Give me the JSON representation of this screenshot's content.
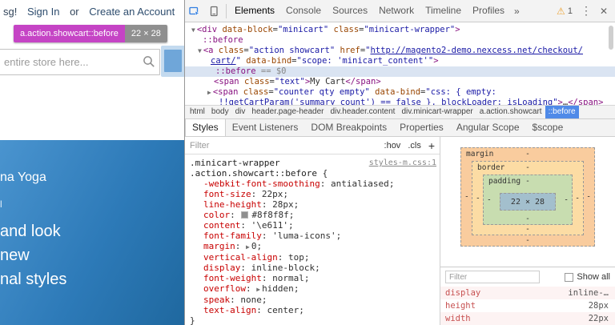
{
  "page": {
    "welcome_suffix": "sg!",
    "sign_in": "Sign In",
    "or_text": "or",
    "create_account": "Create an Account",
    "tooltip": {
      "selector": "a.action.showcart::before",
      "dimensions": "22 × 28"
    },
    "search_placeholder": "entire store here...",
    "hero_lines": [
      "na Yoga",
      "l",
      "and look",
      "new",
      "nal styles"
    ]
  },
  "devtools": {
    "tabs": [
      "Elements",
      "Console",
      "Sources",
      "Network",
      "Timeline",
      "Profiles",
      "»"
    ],
    "warning_count": "1",
    "breadcrumbs": [
      "html",
      "body",
      "div",
      "header.page-header",
      "div.header.content",
      "div.minicart-wrapper",
      "a.action.showcart",
      "::before"
    ],
    "subtabs": [
      "Styles",
      "Event Listeners",
      "DOM Breakpoints",
      "Properties",
      "Angular Scope",
      "$scope"
    ],
    "tree": {
      "l1": [
        {
          "t": "▼",
          "c": "arr"
        },
        {
          "t": "<div ",
          "c": "tag"
        },
        {
          "t": "data-block",
          "c": "attr"
        },
        {
          "t": "=",
          "c": "pln"
        },
        {
          "t": "\"minicart\"",
          "c": "val"
        },
        {
          "t": " ",
          "c": "pln"
        },
        {
          "t": "class",
          "c": "attr"
        },
        {
          "t": "=",
          "c": "pln"
        },
        {
          "t": "\"minicart-wrapper\"",
          "c": "val"
        },
        {
          "t": ">",
          "c": "tag"
        }
      ],
      "l2": [
        {
          "t": "::before",
          "c": "tag"
        }
      ],
      "l3": [
        {
          "t": "▼",
          "c": "arr"
        },
        {
          "t": "<a ",
          "c": "tag"
        },
        {
          "t": "class",
          "c": "attr"
        },
        {
          "t": "=",
          "c": "pln"
        },
        {
          "t": "\"action showcart\"",
          "c": "val"
        },
        {
          "t": " ",
          "c": "pln"
        },
        {
          "t": "href",
          "c": "attr"
        },
        {
          "t": "=",
          "c": "pln"
        },
        {
          "t": "\"",
          "c": "val"
        },
        {
          "t": "http://magento2-demo.nexcess.net/checkout/",
          "c": "lnk"
        }
      ],
      "l4": [
        {
          "t": "cart/",
          "c": "lnk"
        },
        {
          "t": "\"",
          "c": "val"
        },
        {
          "t": " ",
          "c": "pln"
        },
        {
          "t": "data-bind",
          "c": "attr"
        },
        {
          "t": "=",
          "c": "pln"
        },
        {
          "t": "\"scope: 'minicart_content'\"",
          "c": "val"
        },
        {
          "t": ">",
          "c": "tag"
        }
      ],
      "l5": [
        {
          "t": "::before",
          "c": "tag"
        },
        {
          "t": " == $0",
          "c": "meta"
        }
      ],
      "l6": [
        {
          "t": "<span ",
          "c": "tag"
        },
        {
          "t": "class",
          "c": "attr"
        },
        {
          "t": "=",
          "c": "pln"
        },
        {
          "t": "\"text\"",
          "c": "val"
        },
        {
          "t": ">",
          "c": "tag"
        },
        {
          "t": "My Cart",
          "c": "pln"
        },
        {
          "t": "</span>",
          "c": "tag"
        }
      ],
      "l7": [
        {
          "t": "▶",
          "c": "arr"
        },
        {
          "t": "<span ",
          "c": "tag"
        },
        {
          "t": "class",
          "c": "attr"
        },
        {
          "t": "=",
          "c": "pln"
        },
        {
          "t": "\"counter qty empty\"",
          "c": "val"
        },
        {
          "t": " ",
          "c": "pln"
        },
        {
          "t": "data-bind",
          "c": "attr"
        },
        {
          "t": "=",
          "c": "pln"
        },
        {
          "t": "\"css: { empty:",
          "c": "val"
        }
      ],
      "l8": [
        {
          "t": "!!getCartParam('summary_count') == false }, blockLoader: isLoading\"",
          "c": "val"
        },
        {
          "t": ">",
          "c": "tag"
        },
        {
          "t": "…",
          "c": "pln"
        },
        {
          "t": "</span>",
          "c": "tag"
        }
      ]
    },
    "styles": {
      "filter_placeholder": "Filter",
      "toggles": {
        "hov": ":hov",
        "cls": ".cls",
        "plus": "+"
      },
      "source": "styles-m.css:1",
      "sel1": [
        {
          "t": ".minicart-wrapper",
          "c": "sel"
        }
      ],
      "sel2": [
        {
          "t": ".action.showcart::before",
          "c": "sel"
        },
        {
          "t": " {",
          "c": "pln"
        }
      ],
      "p1": [
        {
          "t": "-webkit-font-smoothing",
          "c": "prop"
        },
        {
          "t": ": ",
          "c": "pln"
        },
        {
          "t": "antialiased",
          "c": "cval"
        },
        {
          "t": ";",
          "c": "pln"
        }
      ],
      "p2": [
        {
          "t": "font-size",
          "c": "prop"
        },
        {
          "t": ": ",
          "c": "pln"
        },
        {
          "t": "22px",
          "c": "cval"
        },
        {
          "t": ";",
          "c": "pln"
        }
      ],
      "p3": [
        {
          "t": "line-height",
          "c": "prop"
        },
        {
          "t": ": ",
          "c": "pln"
        },
        {
          "t": "28px",
          "c": "cval"
        },
        {
          "t": ";",
          "c": "pln"
        }
      ],
      "p4": [
        {
          "t": "color",
          "c": "prop"
        },
        {
          "t": ": ",
          "c": "pln"
        },
        {
          "t": "#8f8f8f",
          "c": "swatch"
        },
        {
          "t": "#8f8f8f",
          "c": "cval"
        },
        {
          "t": ";",
          "c": "pln"
        }
      ],
      "p5": [
        {
          "t": "content",
          "c": "prop"
        },
        {
          "t": ": ",
          "c": "pln"
        },
        {
          "t": "'\\e611'",
          "c": "cval"
        },
        {
          "t": ";",
          "c": "pln"
        }
      ],
      "p6": [
        {
          "t": "font-family",
          "c": "prop"
        },
        {
          "t": ": ",
          "c": "pln"
        },
        {
          "t": "'luma-icons'",
          "c": "cval"
        },
        {
          "t": ";",
          "c": "pln"
        }
      ],
      "p7": [
        {
          "t": "margin",
          "c": "prop"
        },
        {
          "t": ": ",
          "c": "pln"
        },
        {
          "t": "▶",
          "c": "arr"
        },
        {
          "t": "0",
          "c": "cval"
        },
        {
          "t": ";",
          "c": "pln"
        }
      ],
      "p8": [
        {
          "t": "vertical-align",
          "c": "prop"
        },
        {
          "t": ": ",
          "c": "pln"
        },
        {
          "t": "top",
          "c": "cval"
        },
        {
          "t": ";",
          "c": "pln"
        }
      ],
      "p9": [
        {
          "t": "display",
          "c": "prop"
        },
        {
          "t": ": ",
          "c": "pln"
        },
        {
          "t": "inline-block",
          "c": "cval"
        },
        {
          "t": ";",
          "c": "pln"
        }
      ],
      "p10": [
        {
          "t": "font-weight",
          "c": "prop"
        },
        {
          "t": ": ",
          "c": "pln"
        },
        {
          "t": "normal",
          "c": "cval"
        },
        {
          "t": ";",
          "c": "pln"
        }
      ],
      "p11": [
        {
          "t": "overflow",
          "c": "prop"
        },
        {
          "t": ": ",
          "c": "pln"
        },
        {
          "t": "▶",
          "c": "arr"
        },
        {
          "t": "hidden",
          "c": "cval"
        },
        {
          "t": ";",
          "c": "pln"
        }
      ],
      "p12": [
        {
          "t": "speak",
          "c": "prop"
        },
        {
          "t": ": ",
          "c": "pln"
        },
        {
          "t": "none",
          "c": "cval"
        },
        {
          "t": ";",
          "c": "pln"
        }
      ],
      "p13": [
        {
          "t": "text-align",
          "c": "prop"
        },
        {
          "t": ": ",
          "c": "pln"
        },
        {
          "t": "center",
          "c": "cval"
        },
        {
          "t": ";",
          "c": "pln"
        }
      ],
      "close": [
        {
          "t": "}",
          "c": "pln"
        }
      ]
    },
    "box_model": {
      "margin": "margin",
      "border": "border",
      "padding": "padding",
      "content": "22 × 28",
      "dash": "-"
    },
    "computed": {
      "filter_placeholder": "Filter",
      "show_all": "Show all",
      "rows": [
        {
          "name": "display",
          "value": "inline-…"
        },
        {
          "name": "height",
          "value": "28px"
        },
        {
          "name": "width",
          "value": "22px"
        }
      ]
    }
  }
}
